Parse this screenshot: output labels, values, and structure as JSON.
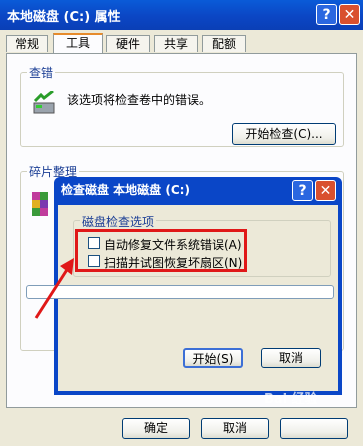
{
  "window": {
    "title": "本地磁盘 (C:) 属性",
    "help": "?",
    "close": "✕"
  },
  "tabs": [
    {
      "label": "常规",
      "active": false
    },
    {
      "label": "工具",
      "active": true
    },
    {
      "label": "硬件",
      "active": false
    },
    {
      "label": "共享",
      "active": false
    },
    {
      "label": "配额",
      "active": false
    }
  ],
  "error_check": {
    "group_label": "查错",
    "description": "该选项将检查卷中的错误。",
    "button": "开始检查(C)..."
  },
  "defrag": {
    "group_label": "碎片整理"
  },
  "dialog": {
    "title": "检查磁盘 本地磁盘 (C:)",
    "group_label": "磁盘检查选项",
    "options": [
      {
        "label": "自动修复文件系统错误(A)",
        "checked": false
      },
      {
        "label": "扫描并试图恢复坏扇区(N)",
        "checked": false
      }
    ],
    "progress": 0,
    "start": "开始(S)",
    "cancel": "取消"
  },
  "footer": {
    "ok": "确定",
    "cancel": "取消"
  },
  "watermark": "Bai 经验",
  "colors": {
    "highlight": "#e01818",
    "titlebar": "#0a46c7"
  }
}
